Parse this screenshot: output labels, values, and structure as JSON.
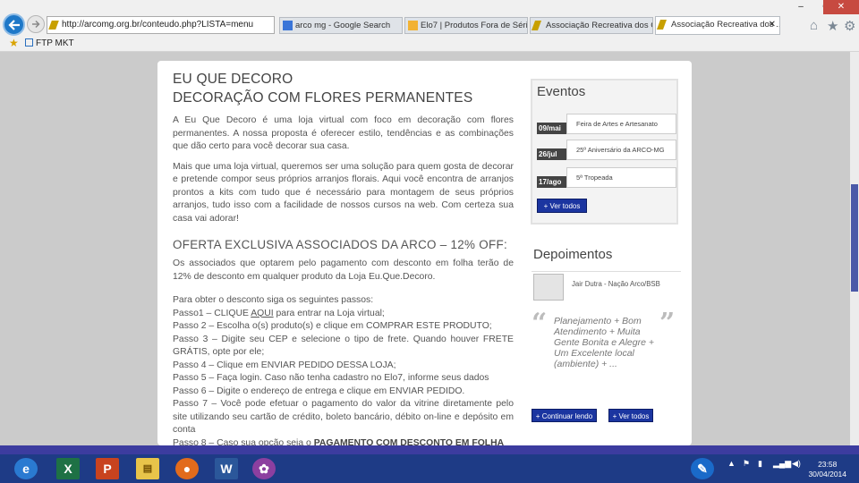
{
  "browser": {
    "address": "http://arcomg.org.br/conteudo.php?LISTA=menu",
    "tabs": [
      {
        "label": "arco mg - Google Search",
        "icon_color": "#3a75d8"
      },
      {
        "label": "Elo7 | Produtos Fora de Série",
        "icon_color": "#f2b233"
      },
      {
        "label": "Associação Recreativa dos Cor...",
        "icon_color": "#c8a000"
      },
      {
        "label": "Associação Recreativa dos ...",
        "icon_color": "#c8a000",
        "active": true
      }
    ],
    "favorites_link": "FTP MKT",
    "window": {
      "minimize": "–",
      "maximize": "▫",
      "close": "✕"
    },
    "right_icons": {
      "home": "⌂",
      "star": "★",
      "gear": "⚙"
    }
  },
  "page": {
    "heading_line1": "EU QUE DECORO",
    "heading_line2": "DECORAÇÃO COM FLORES PERMANENTES",
    "intro_p1": "A Eu Que Decoro é uma loja virtual com foco em decoração com flores permanentes. A nossa proposta é oferecer estilo, tendências e as combinações que dão certo para você decorar sua casa.",
    "intro_p2": "Mais que uma loja virtual, queremos ser uma solução para quem gosta de decorar e pretende compor seus próprios arranjos florais. Aqui você encontra de arranjos prontos a kits com tudo que é necessário para montagem de seus próprios arranjos, tudo isso com a facilidade de nossos cursos na web. Com certeza sua casa vai adorar!",
    "offer_heading": "OFERTA EXCLUSIVA ASSOCIADOS DA ARCO – 12% OFF:",
    "offer_desc": "Os associados que optarem pelo pagamento com desconto em folha terão de 12% de desconto em qualquer produto da Loja Eu.Que.Decoro.",
    "steps_intro": "Para obter o desconto siga os seguintes passos:",
    "step1_pre": "Passo1 – CLIQUE ",
    "step1_link": "AQUI",
    "step1_post": " para entrar na Loja virtual;",
    "step2": "Passo 2 – Escolha o(s) produto(s) e clique em COMPRAR ESTE PRODUTO;",
    "step3": "Passo 3 – Digite seu CEP e selecione o tipo de frete. Quando houver FRETE GRÁTIS, opte por ele;",
    "step4": "Passo 4 – Clique em ENVIAR PEDIDO DESSA LOJA;",
    "step5": "Passo 5 – Faça login. Caso não tenha cadastro no Elo7, informe seus dados",
    "step6": "Passo 6 – Digite o endereço de entrega e clique em ENVIAR PEDIDO.",
    "step7": "Passo 7 – Você pode efetuar o pagamento do valor da vitrine diretamente pelo site utilizando seu cartão de crédito, boleto bancário, débito on-line e depósito em conta",
    "step8_pre": "Passo 8 – Caso sua opção seja o ",
    "step8_bold": "PAGAMENTO COM DESCONTO EM FOLHA"
  },
  "sidebar": {
    "eventos_title": "Eventos",
    "events": [
      {
        "date": "09/mai",
        "name": "Feira de Artes e Artesanato"
      },
      {
        "date": "26/jul",
        "name": "25º Aniversário da ARCO-MG"
      },
      {
        "date": "17/ago",
        "name": "5ª Tropeada"
      }
    ],
    "eventos_button": "+ Ver todos",
    "depoimentos_title": "Depoimentos",
    "depo_author": "Jair Dutra - Nação Arco/BSB",
    "depo_text": "Planejamento + Bom Atendimento + Muita Gente Bonita e Alegre + Um Excelente local (ambiente) + ...",
    "quote_open": "“",
    "quote_close": "”",
    "continuar_button": "+ Continuar lendo",
    "depo_ver_todos": "+ Ver todos"
  },
  "taskbar": {
    "apps": [
      "Internet Explorer",
      "Excel",
      "PowerPoint",
      "File Explorer",
      "Firefox",
      "Word",
      "Picasa"
    ],
    "time": "23:58",
    "date": "30/04/2014"
  }
}
